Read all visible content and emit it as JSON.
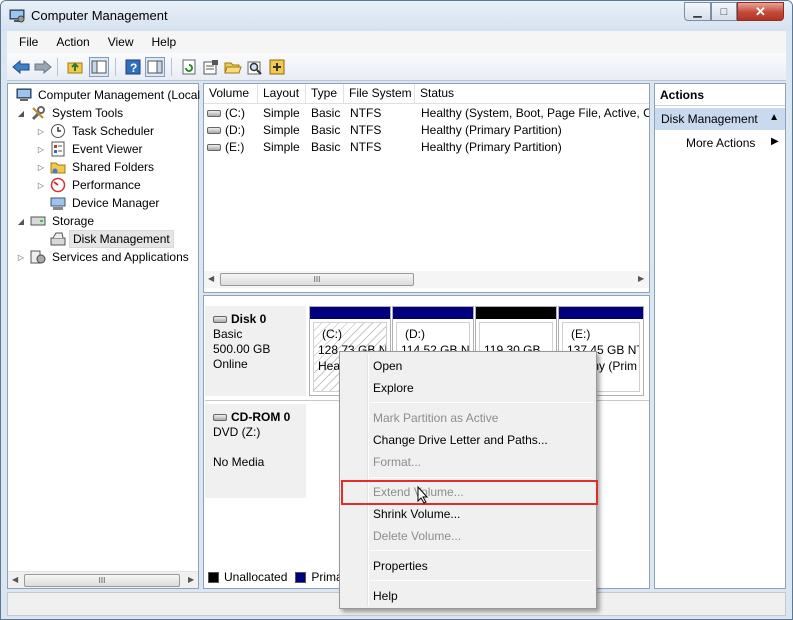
{
  "window": {
    "title": "Computer Management",
    "controls": {
      "minimize": "▁",
      "maximize": "□",
      "close": "✕"
    }
  },
  "menu": [
    "File",
    "Action",
    "View",
    "Help"
  ],
  "toolbar": {
    "icons": [
      "back-arrow-icon",
      "forward-arrow-icon",
      "up-folder-icon",
      "show-hide-tree-icon",
      "help-icon",
      "show-hide-action-pane-icon",
      "refresh-icon",
      "properties-icon",
      "open-folder-icon",
      "search-icon",
      "disk-settings-icon"
    ]
  },
  "tree": {
    "root": "Computer Management (Local",
    "system_tools": "System Tools",
    "task_scheduler": "Task Scheduler",
    "event_viewer": "Event Viewer",
    "shared_folders": "Shared Folders",
    "performance": "Performance",
    "device_manager": "Device Manager",
    "storage": "Storage",
    "disk_management": "Disk Management",
    "services": "Services and Applications"
  },
  "volumes": {
    "headers": [
      "Volume",
      "Layout",
      "Type",
      "File System",
      "Status"
    ],
    "rows": [
      {
        "volume": "(C:)",
        "layout": "Simple",
        "type": "Basic",
        "fs": "NTFS",
        "status": "Healthy (System, Boot, Page File, Active, Cr"
      },
      {
        "volume": "(D:)",
        "layout": "Simple",
        "type": "Basic",
        "fs": "NTFS",
        "status": "Healthy (Primary Partition)"
      },
      {
        "volume": "(E:)",
        "layout": "Simple",
        "type": "Basic",
        "fs": "NTFS",
        "status": "Healthy (Primary Partition)"
      }
    ]
  },
  "disks": {
    "disk0": {
      "name": "Disk 0",
      "type": "Basic",
      "size": "500.00 GB",
      "state": "Online"
    },
    "cdrom0": {
      "name": "CD-ROM 0",
      "type": "DVD (Z:)",
      "state": "No Media"
    },
    "partitions": [
      {
        "label": "(C:)",
        "size": "128.73 GB NT",
        "status": "Hea"
      },
      {
        "label": "(D:)",
        "size": "114.52 GB NT",
        "status": ""
      },
      {
        "label": "",
        "size": "119.30 GB",
        "status": ""
      },
      {
        "label": "(E:)",
        "size": "137.45 GB NT",
        "status": "thy (Prim"
      }
    ],
    "bar_colors": {
      "primary": "#00007f",
      "unallocated": "#000000"
    }
  },
  "legend": {
    "unallocated": "Unallocated",
    "primary": "Prima"
  },
  "actions": {
    "title": "Actions",
    "section": "Disk Management",
    "more": "More Actions"
  },
  "context_menu": {
    "open": "Open",
    "explore": "Explore",
    "mark_active": "Mark Partition as Active",
    "change_letter": "Change Drive Letter and Paths...",
    "format": "Format...",
    "extend": "Extend Volume...",
    "shrink": "Shrink Volume...",
    "delete": "Delete Volume...",
    "properties": "Properties",
    "help": "Help"
  },
  "scroll_thumb_grip": "III",
  "colors": {
    "highlight_box": "#e22d2d",
    "action_section_bg": "#c9d9ee"
  }
}
